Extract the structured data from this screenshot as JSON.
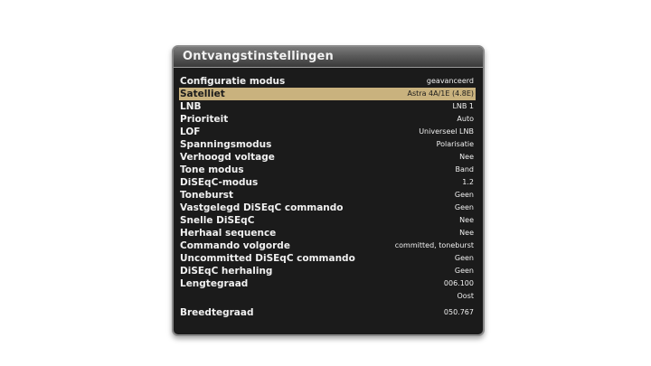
{
  "window": {
    "title": "Ontvangstinstellingen"
  },
  "settings": [
    {
      "label": "Configuratie modus",
      "value": "geavanceerd",
      "selected": false
    },
    {
      "label": "Satelliet",
      "value": "Astra 4A/1E (4.8E)",
      "selected": true
    },
    {
      "label": "LNB",
      "value": "LNB 1",
      "selected": false
    },
    {
      "label": "Prioriteit",
      "value": "Auto",
      "selected": false
    },
    {
      "label": "LOF",
      "value": "Universeel LNB",
      "selected": false
    },
    {
      "label": "Spanningsmodus",
      "value": "Polarisatie",
      "selected": false
    },
    {
      "label": "Verhoogd voltage",
      "value": "Nee",
      "selected": false
    },
    {
      "label": "Tone modus",
      "value": "Band",
      "selected": false
    },
    {
      "label": "DiSEqC-modus",
      "value": "1.2",
      "selected": false
    },
    {
      "label": "Toneburst",
      "value": "Geen",
      "selected": false
    },
    {
      "label": "Vastgelegd DiSEqC commando",
      "value": "Geen",
      "selected": false
    },
    {
      "label": "Snelle DiSEqC",
      "value": "Nee",
      "selected": false
    },
    {
      "label": "Herhaal sequence",
      "value": "Nee",
      "selected": false
    },
    {
      "label": "Commando volgorde",
      "value": "committed, toneburst",
      "selected": false
    },
    {
      "label": "Uncommitted DiSEqC commando",
      "value": "Geen",
      "selected": false
    },
    {
      "label": "DiSEqC herhaling",
      "value": "Geen",
      "selected": false
    },
    {
      "label": "Lengtegraad",
      "value": "006.100",
      "selected": false
    },
    {
      "label": "",
      "value": "Oost",
      "selected": false
    },
    {
      "label": "Breedtegraad",
      "value": "050.767",
      "selected": false
    }
  ],
  "colors": {
    "selection": "#c9b27e",
    "background": "#1b1b1b"
  }
}
